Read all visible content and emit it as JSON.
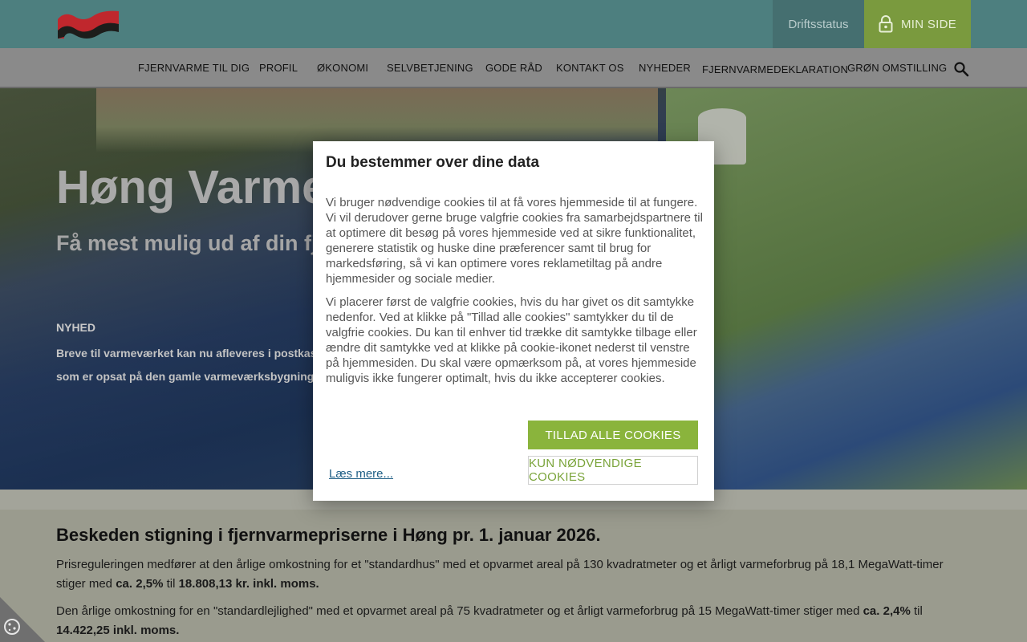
{
  "header": {
    "driftsstatus": "Driftsstatus",
    "min_side": "MIN SIDE"
  },
  "nav": {
    "items": [
      {
        "label": "FJERNVARME TIL DIG"
      },
      {
        "label": "PROFIL"
      },
      {
        "label": "ØKONOMI"
      },
      {
        "label": "SELVBETJENING"
      },
      {
        "label": "GODE RÅD"
      },
      {
        "label": "KONTAKT OS"
      },
      {
        "label": "NYHEDER"
      },
      {
        "label": "FJERNVARMEDEKLARATION"
      },
      {
        "label": "GRØN OMSTILLING"
      }
    ]
  },
  "hero": {
    "title": "Høng Varmev",
    "subtitle": "Få mest mulig ud af din fjer",
    "news_label": "NYHED",
    "news_text_1": "Breve til varmeværket kan nu afleveres i postkass",
    "news_text_2": "som er opsat på den gamle  varmeværksbygning p"
  },
  "article": {
    "title": "Beskeden stigning i fjernvarmepriserne i Høng pr. 1. januar 2026.",
    "p1_a": "Prisreguleringen medfører at den årlige omkostning for et \"standardhus\" med et opvarmet areal på 130 kvadratmeter og et årligt varmeforbrug på 18,1 MegaWatt-timer stiger med ",
    "p1_b1": "ca. 2,5%",
    "p1_c": " til ",
    "p1_b2": "18.808,13 kr. inkl. moms.",
    "p2_a": "Den årlige omkostning for en \"standardlejlighed\" med et opvarmet areal på 75 kvadratmeter og et årligt varmeforbrug på 15 MegaWatt-timer stiger med ",
    "p2_b1": "ca. 2,4%",
    "p2_c": " til ",
    "p2_b2": "14.422,25 inkl. moms."
  },
  "modal": {
    "title": "Du bestemmer over dine data",
    "p1": "Vi bruger nødvendige cookies til at få vores hjemmeside til at fungere. Vi vil derudover gerne bruge valgfrie cookies fra samarbejdspartnere til at optimere dit besøg på vores hjemmeside ved at sikre funktionalitet, generere statistik og huske dine præferencer samt til brug for markedsføring, så vi kan optimere vores reklametiltag på andre hjemmesider og sociale medier.",
    "p2": "Vi placerer først de valgfrie cookies, hvis du har givet os dit samtykke nedenfor. Ved at klikke på \"Tillad alle cookies\" samtykker du til de valgfrie cookies. Du kan til enhver tid trække dit samtykke tilbage eller ændre dit samtykke ved at klikke på cookie-ikonet nederst til venstre på hjemmesiden. Du skal være opmærksom på, at vores hjemmeside muligvis ikke fungerer optimalt, hvis du ikke accepterer cookies.",
    "allow_all": "TILLAD ALLE COOKIES",
    "necessary_only": "KUN NØDVENDIGE COOKIES",
    "read_more": "Læs mere..."
  },
  "colors": {
    "topbar": "#4d7f7f",
    "accent_green": "#8ab43c",
    "link": "#1f5f86"
  }
}
